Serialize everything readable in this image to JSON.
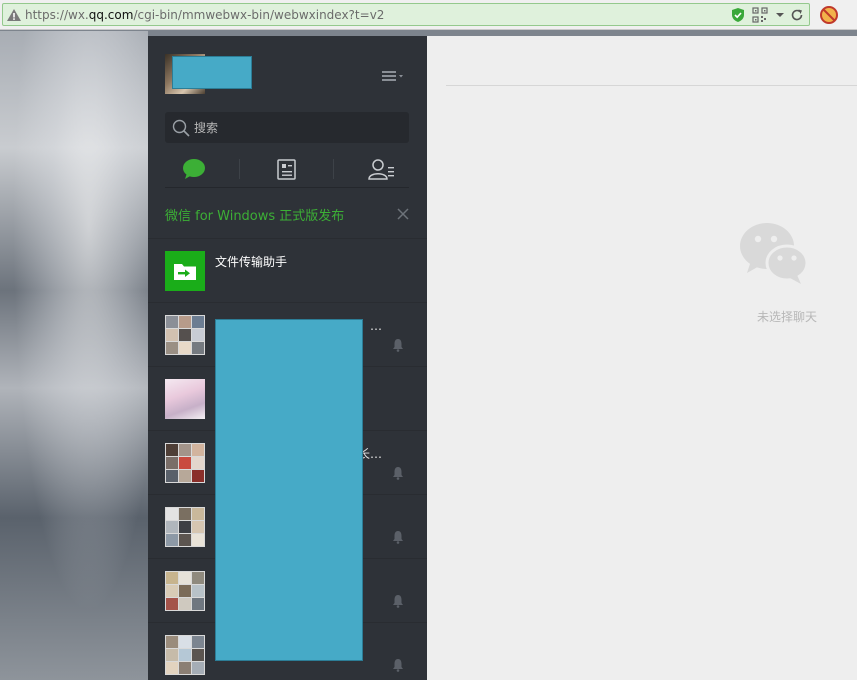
{
  "browser": {
    "url_prefix": "https://wx.",
    "url_host": "qq.com",
    "url_path": "/cgi-bin/mmwebwx-bin/webwxindex?t=v2"
  },
  "sidebar": {
    "search": {
      "placeholder": "搜索"
    },
    "tabs": [
      {
        "id": "chat",
        "icon": "chat-bubble-icon",
        "active": true
      },
      {
        "id": "articles",
        "icon": "article-icon",
        "active": false
      },
      {
        "id": "contacts",
        "icon": "contacts-icon",
        "active": false
      }
    ],
    "notice": {
      "text": "微信 for Windows 正式版发布"
    },
    "chats": [
      {
        "name": "文件传输助手",
        "name_tail": "",
        "muted": false,
        "avatar": "file-transfer-icon"
      },
      {
        "name": "",
        "name_tail": "、…",
        "muted": true,
        "avatar": "group-avatar"
      },
      {
        "name": "",
        "name_tail": "",
        "muted": false,
        "avatar": "user-avatar"
      },
      {
        "name": "",
        "name_tail": "长…",
        "muted": true,
        "avatar": "group-avatar"
      },
      {
        "name": "",
        "name_tail": "",
        "muted": true,
        "avatar": "group-avatar"
      },
      {
        "name": "",
        "name_tail": "",
        "muted": true,
        "avatar": "group-avatar"
      },
      {
        "name": "",
        "name_tail": "",
        "muted": true,
        "avatar": "group-avatar"
      }
    ]
  },
  "main": {
    "empty_text": "未选择聊天"
  },
  "colors": {
    "sidebar_bg": "#2e3238",
    "accent_green": "#3caf36",
    "redaction": "#46aac7",
    "main_bg": "#eeeeee"
  }
}
